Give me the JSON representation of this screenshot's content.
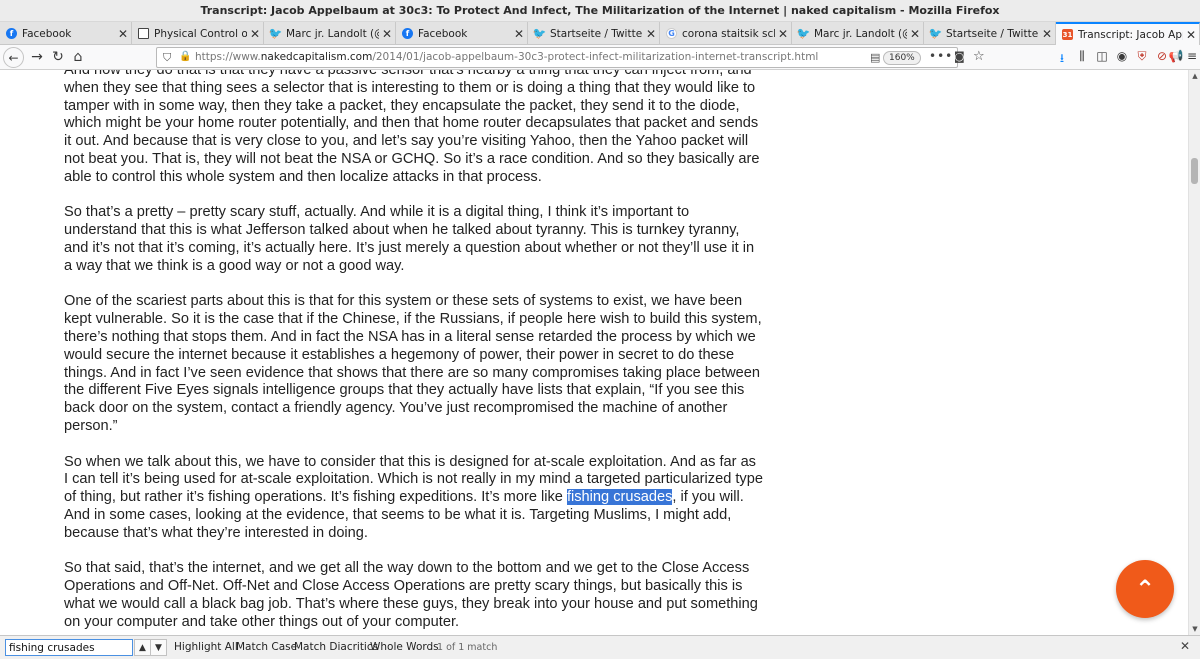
{
  "window": {
    "title": "Transcript: Jacob Appelbaum at 30c3: To Protect And Infect, The Militarization of the Internet | naked capitalism - Mozilla Firefox"
  },
  "tabs": [
    {
      "label": "Facebook",
      "icon": "facebook-icon"
    },
    {
      "label": "Physical Control of the",
      "icon": "document-icon"
    },
    {
      "label": "Marc jr. Landolt (@Pin",
      "icon": "twitter-icon"
    },
    {
      "label": "Facebook",
      "icon": "facebook-icon"
    },
    {
      "label": "Startseite / Twitter",
      "icon": "twitter-icon"
    },
    {
      "label": "corona staitsik schweiz",
      "icon": "google-icon"
    },
    {
      "label": "Marc jr. Landolt (@Pin",
      "icon": "twitter-icon"
    },
    {
      "label": "Startseite / Twitter",
      "icon": "twitter-icon"
    },
    {
      "label": "Transcript: Jacob Appe",
      "icon": "naked-capitalism-icon",
      "active": true
    }
  ],
  "navbar": {
    "url_prefix": "https://www.",
    "url_host": "nakedcapitalism.com",
    "url_path": "/2014/01/jacob-appelbaum-30c3-protect-infect-militarization-internet-transcript.html",
    "zoom": "160%"
  },
  "article": {
    "p1": "And how they do that is that they have a passive sensor that’s nearby a thing that they can inject from, and when they see that thing sees a selector that is interesting to them or is doing a thing that they would like to tamper with in some way, then they take a packet, they encapsulate the packet, they send it to the diode, which might be your home router potentially, and then that home router decapsulates that packet and sends it out. And because that is very close to you, and let’s say you’re visiting Yahoo, then the Yahoo packet will not beat you. That is, they will not beat the NSA or GCHQ. So it’s a race condition. And so they basically are able to control this whole system and then localize attacks in that process.",
    "p2": "So that’s a pretty – pretty scary stuff, actually. And while it is a digital thing, I think it’s important to understand that this is what Jefferson talked about when he talked about tyranny. This is turnkey tyranny, and it’s not that it’s coming, it’s actually here. It’s just merely a question about whether or not they’ll use it in a way that we think is a good way or not a good way.",
    "p3": "One of the scariest parts about this is that for this system or these sets of systems to exist, we have been kept vulnerable. So it is the case that if the Chinese, if the Russians, if people here wish to build this system, there’s nothing that stops them. And in fact the NSA has in a literal sense retarded the process by which we would secure the internet because it establishes a hegemony of power, their power in secret to do these things. And in fact I’ve seen evidence that shows that there are so many compromises taking place between the different Five Eyes signals intelligence groups that they actually have lists that explain, “If you see this back door on the system, contact a friendly agency. You’ve just recompromised the machine of another person.”",
    "p4_before": "So when we talk about this, we have to consider that this is designed for at-scale exploitation. And as far as I can tell it’s being used for at-scale exploitation. Which is not really in my mind a targeted particularized type of thing, but rather it’s fishing operations. It’s fishing expeditions. It’s more like ",
    "p4_highlight": "fishing crusades",
    "p4_after": ", if you will. And in some cases, looking at the evidence, that seems to be what it is. Targeting Muslims, I might add, because that’s what they’re interested in doing.",
    "p5": "So that said, that’s the internet, and we get all the way down to the bottom and we get to the Close Access Operations and Off-Net. Off-Net and Close Access Operations are pretty scary things, but basically this is what we would call a black bag job. That’s where these guys, they break into your house and put something on your computer and take other things out of your computer."
  },
  "findbar": {
    "query": "fishing crusades",
    "highlight_all": "Highlight All",
    "match_case": "Match Case",
    "match_diacritics": "Match Diacritics",
    "whole_words": "Whole Words",
    "status": "1 of 1 match"
  },
  "colors": {
    "accent": "#0a84ff",
    "highlight": "#3875d7",
    "fab": "#f05a1a"
  }
}
